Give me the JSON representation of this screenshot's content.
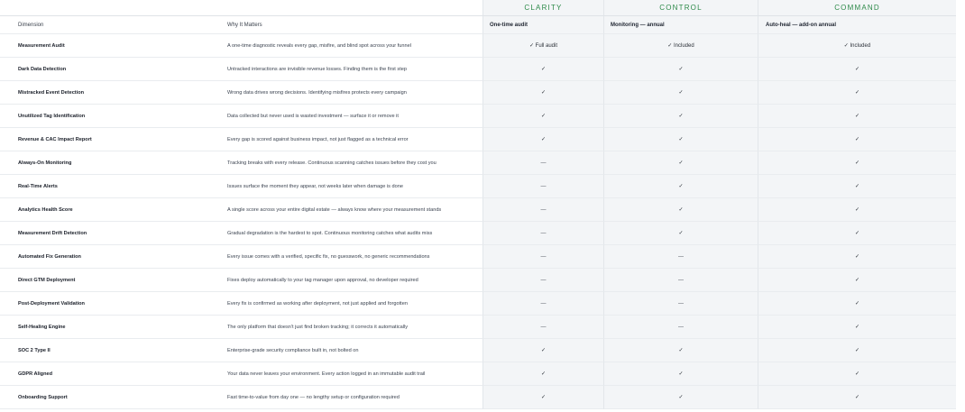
{
  "tiers": [
    {
      "name": "CLARITY",
      "subtitle": "One-time audit"
    },
    {
      "name": "CONTROL",
      "subtitle": "Monitoring — annual"
    },
    {
      "name": "COMMAND",
      "subtitle": "Auto-heal — add-on annual"
    }
  ],
  "columns": {
    "dimension": "Dimension",
    "why": "Why It Matters"
  },
  "rows": [
    {
      "dimension": "Measurement Audit",
      "why": "A one-time diagnostic reveals every gap, misfire, and blind spot across your funnel",
      "clarity": "✓ Full audit",
      "control": "✓ Included",
      "command": "✓ Included"
    },
    {
      "dimension": "Dark Data Detection",
      "why": "Untracked interactions are invisible revenue losses. Finding them is the first step",
      "clarity": "✓",
      "control": "✓",
      "command": "✓"
    },
    {
      "dimension": "Mistracked Event Detection",
      "why": "Wrong data drives wrong decisions. Identifying misfires protects every campaign",
      "clarity": "✓",
      "control": "✓",
      "command": "✓"
    },
    {
      "dimension": "Unutilized Tag Identification",
      "why": "Data collected but never used is wasted investment — surface it or remove it",
      "clarity": "✓",
      "control": "✓",
      "command": "✓"
    },
    {
      "dimension": "Revenue & CAC Impact Report",
      "why": "Every gap is scored against business impact, not just flagged as a technical error",
      "clarity": "✓",
      "control": "✓",
      "command": "✓"
    },
    {
      "dimension": "Always-On Monitoring",
      "why": "Tracking breaks with every release. Continuous scanning catches issues before they cost you",
      "clarity": "—",
      "control": "✓",
      "command": "✓"
    },
    {
      "dimension": "Real-Time Alerts",
      "why": "Issues surface the moment they appear, not weeks later when damage is done",
      "clarity": "—",
      "control": "✓",
      "command": "✓"
    },
    {
      "dimension": "Analytics Health Score",
      "why": "A single score across your entire digital estate — always know where your measurement stands",
      "clarity": "—",
      "control": "✓",
      "command": "✓"
    },
    {
      "dimension": "Measurement Drift Detection",
      "why": "Gradual degradation is the hardest to spot. Continuous monitoring catches what audits miss",
      "clarity": "—",
      "control": "✓",
      "command": "✓"
    },
    {
      "dimension": "Automated Fix Generation",
      "why": "Every issue comes with a verified, specific fix, no guesswork, no generic recommendations",
      "clarity": "—",
      "control": "—",
      "command": "✓"
    },
    {
      "dimension": "Direct GTM Deployment",
      "why": "Fixes deploy automatically to your tag manager upon approval, no developer required",
      "clarity": "—",
      "control": "—",
      "command": "✓"
    },
    {
      "dimension": "Post-Deployment Validation",
      "why": "Every fix is confirmed as working after deployment, not just applied and forgotten",
      "clarity": "—",
      "control": "—",
      "command": "✓"
    },
    {
      "dimension": "Self-Healing Engine",
      "why": "The only platform that doesn't just find broken tracking; it corrects it automatically",
      "clarity": "—",
      "control": "—",
      "command": "✓"
    },
    {
      "dimension": "SOC 2 Type II",
      "why": "Enterprise-grade security compliance built in, not bolted on",
      "clarity": "✓",
      "control": "✓",
      "command": "✓"
    },
    {
      "dimension": "GDPR Aligned",
      "why": "Your data never leaves your environment. Every action logged in an immutable audit trail",
      "clarity": "✓",
      "control": "✓",
      "command": "✓"
    },
    {
      "dimension": "Onboarding Support",
      "why": "Fast time-to-value from day one — no lengthy setup or configuration required",
      "clarity": "✓",
      "control": "✓",
      "command": "✓"
    }
  ]
}
